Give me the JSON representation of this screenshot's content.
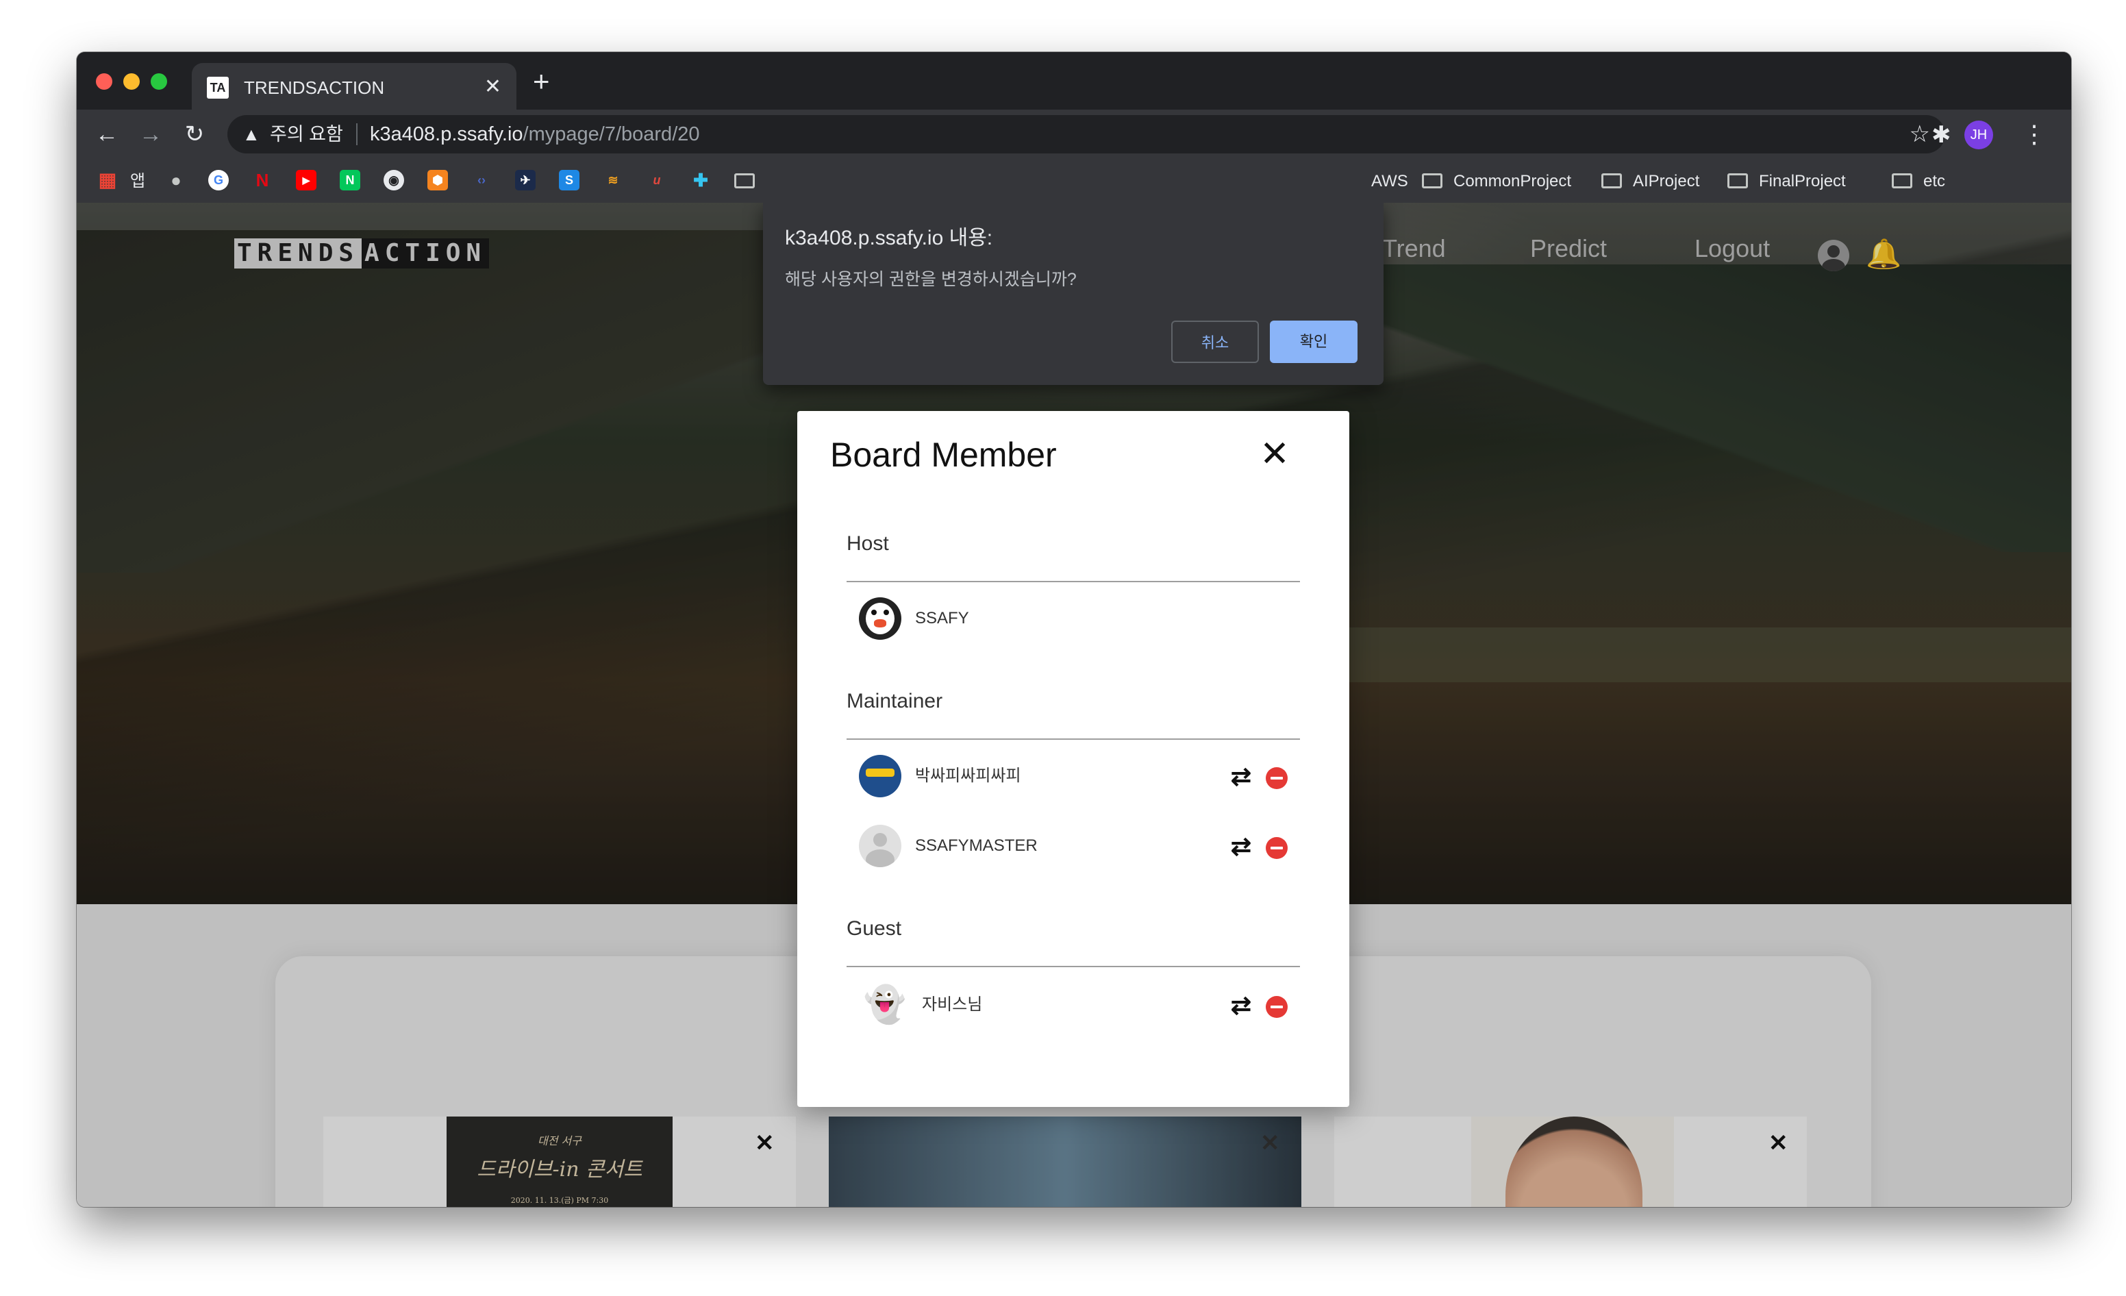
{
  "browser": {
    "tab_title": "TRENDSACTION",
    "tab_close": "✕",
    "new_tab": "+",
    "favicon": "TA",
    "security_warning": "주의 요함",
    "url_host": "k3a408.p.ssafy.io",
    "url_path": "/mypage/7/board/20",
    "profile_initials": "JH",
    "bookmarks": [
      {
        "label": "앱"
      },
      {
        "label": "AWS"
      },
      {
        "label": "CommonProject"
      },
      {
        "label": "AIProject"
      },
      {
        "label": "FinalProject"
      },
      {
        "label": "etc"
      }
    ]
  },
  "site": {
    "logo_left": "TRENDS",
    "logo_right": "ACTION",
    "nav": {
      "trend": "Trend",
      "predict": "Predict",
      "logout": "Logout"
    }
  },
  "cards": [
    {
      "poster_top": "대전 서구",
      "poster_title": "드라이브-in 콘서트",
      "poster_date": "2020. 11. 13.(금) PM 7:30"
    },
    {},
    {}
  ],
  "modal": {
    "title": "Board Member",
    "sections": [
      {
        "label": "Host",
        "members": [
          {
            "name": "SSAFY",
            "avatar": "penguin-emoji"
          }
        ]
      },
      {
        "label": "Maintainer",
        "members": [
          {
            "name": "박싸피싸피싸피",
            "avatar": "sunglasses-avatar"
          },
          {
            "name": "SSAFYMASTER",
            "avatar": "default-user"
          }
        ]
      },
      {
        "label": "Guest",
        "members": [
          {
            "name": "자비스님",
            "avatar": "ghost-emoji"
          }
        ]
      }
    ]
  },
  "alert": {
    "title": "k3a408.p.ssafy.io 내용:",
    "message": "해당 사용자의 권한을 변경하시겠습니까?",
    "cancel_label": "취소",
    "ok_label": "확인"
  },
  "colors": {
    "accent": "#8ab4f8",
    "remove": "#e53935",
    "chrome_dark": "#202124"
  }
}
